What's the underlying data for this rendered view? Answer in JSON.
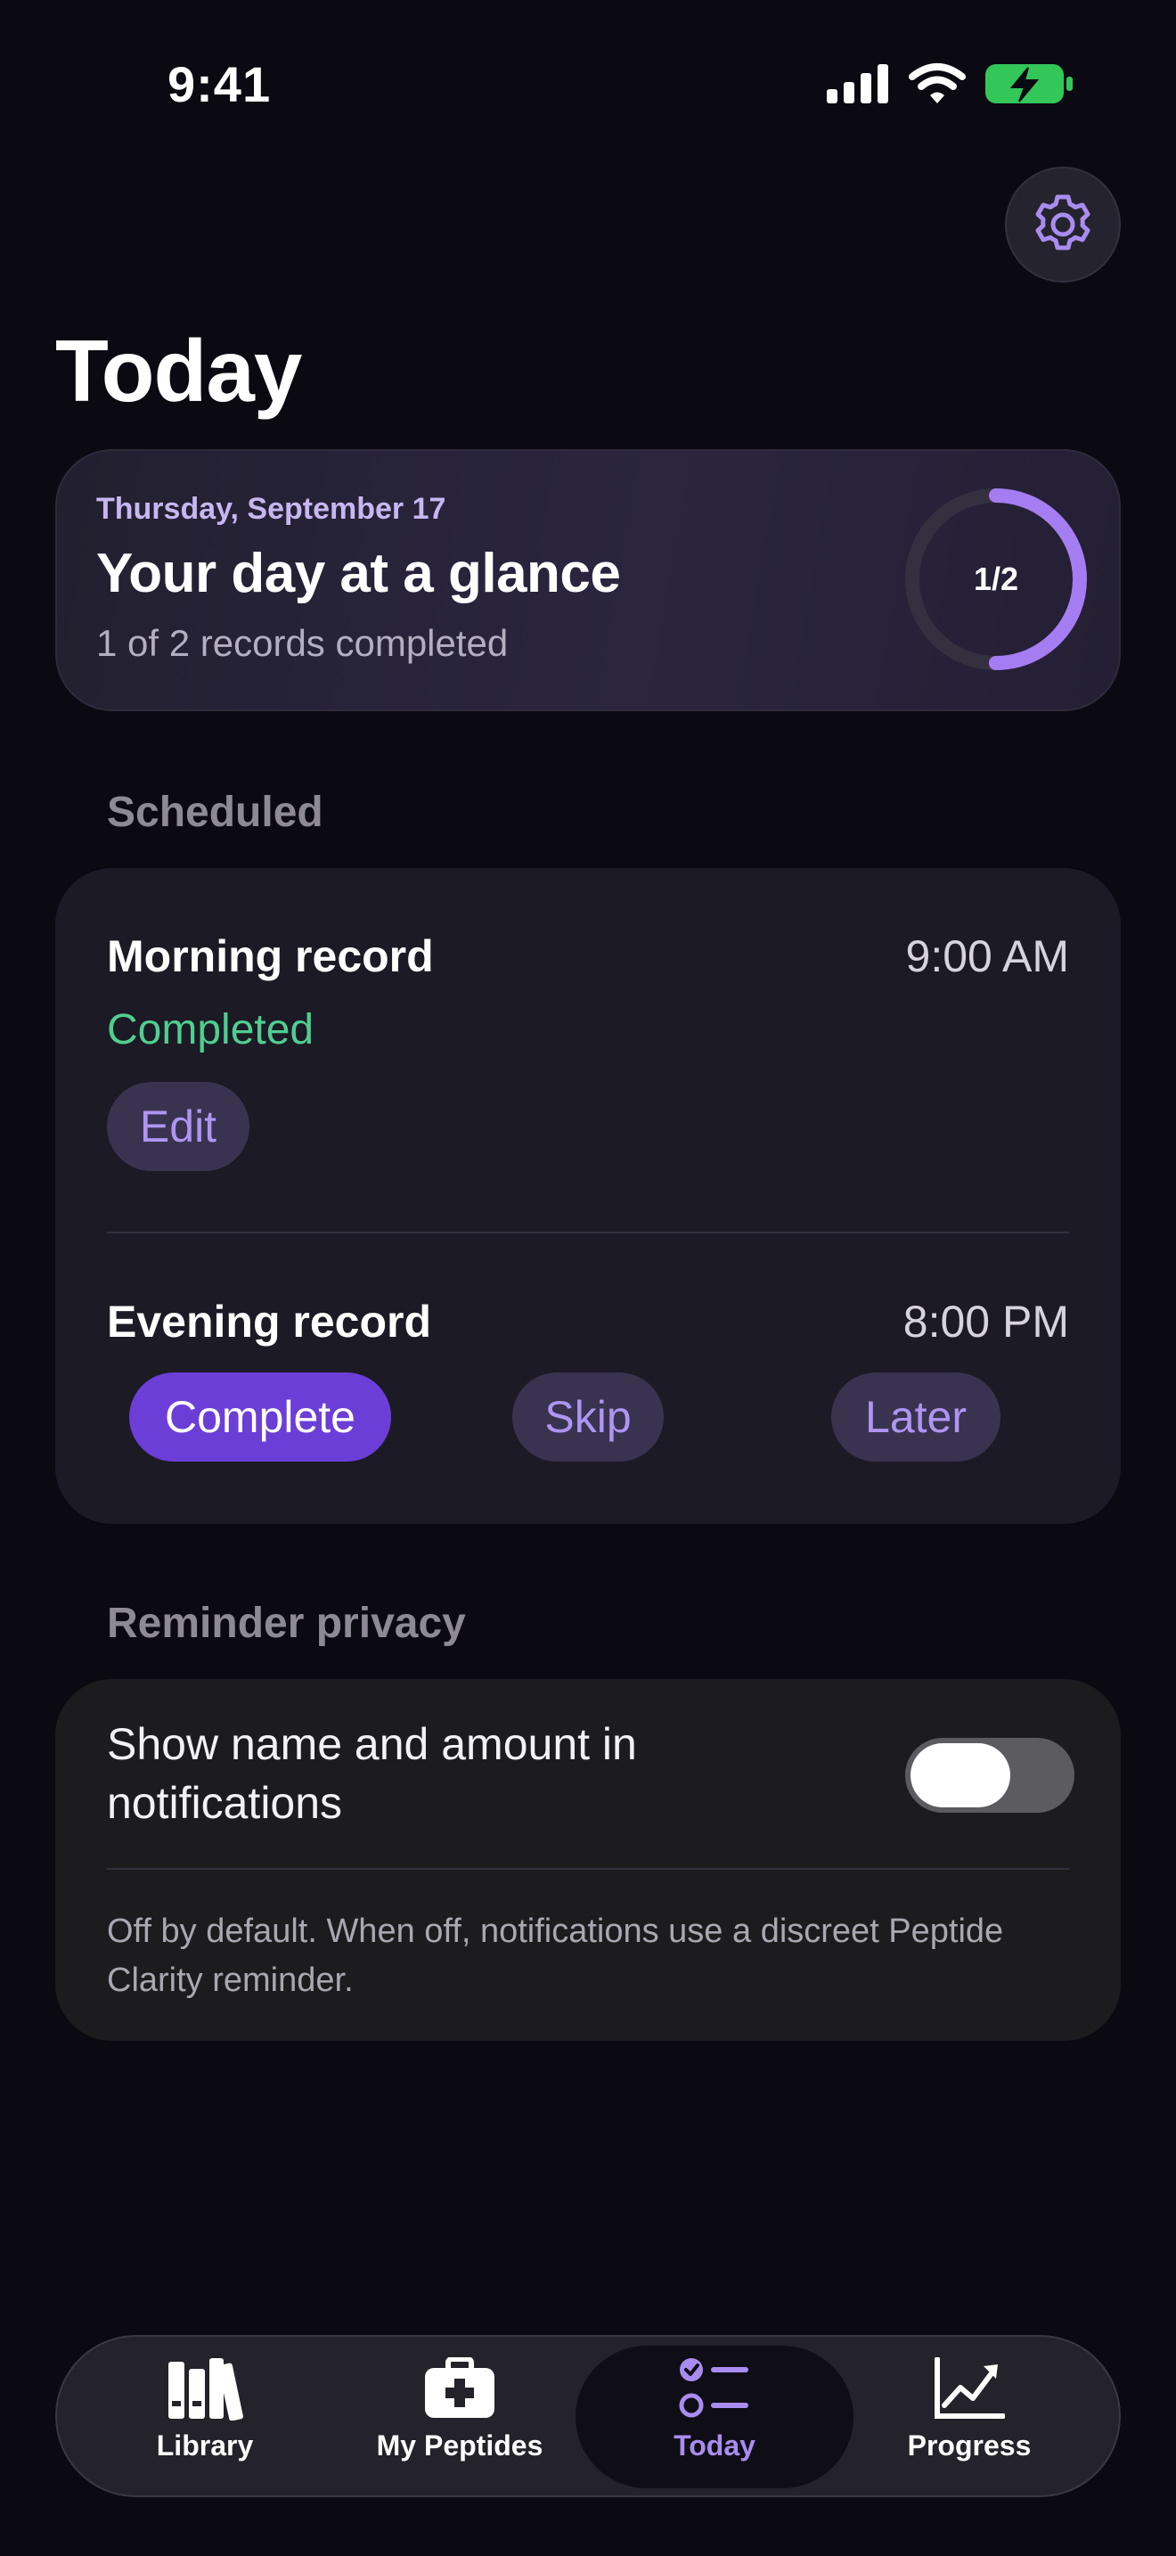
{
  "status_bar": {
    "time": "9:41"
  },
  "header": {
    "title": "Today"
  },
  "glance": {
    "date": "Thursday, September 17",
    "headline": "Your day at a glance",
    "subtitle": "1 of 2 records completed",
    "progress_label": "1/2",
    "progress_fraction": 0.5,
    "ring_color": "#a57df2"
  },
  "scheduled": {
    "section_label": "Scheduled",
    "records": [
      {
        "title": "Morning record",
        "time": "9:00 AM",
        "status": "Completed",
        "edit_label": "Edit"
      },
      {
        "title": "Evening record",
        "time": "8:00 PM",
        "complete_label": "Complete",
        "skip_label": "Skip",
        "later_label": "Later"
      }
    ]
  },
  "privacy": {
    "section_label": "Reminder privacy",
    "toggle_label": "Show name and amount in notifications",
    "toggle_on": false,
    "note": "Off by default. When off, notifications use a discreet Peptide Clarity reminder."
  },
  "tabbar": {
    "items": [
      {
        "label": "Library",
        "icon": "library-icon"
      },
      {
        "label": "My Peptides",
        "icon": "medkit-icon"
      },
      {
        "label": "Today",
        "icon": "checklist-icon",
        "active": true
      },
      {
        "label": "Progress",
        "icon": "chart-line-icon"
      }
    ]
  },
  "colors": {
    "accent": "#6c3ed8",
    "accent_light": "#a98cf0",
    "success": "#4fcf8f",
    "background": "#0b0a12"
  }
}
